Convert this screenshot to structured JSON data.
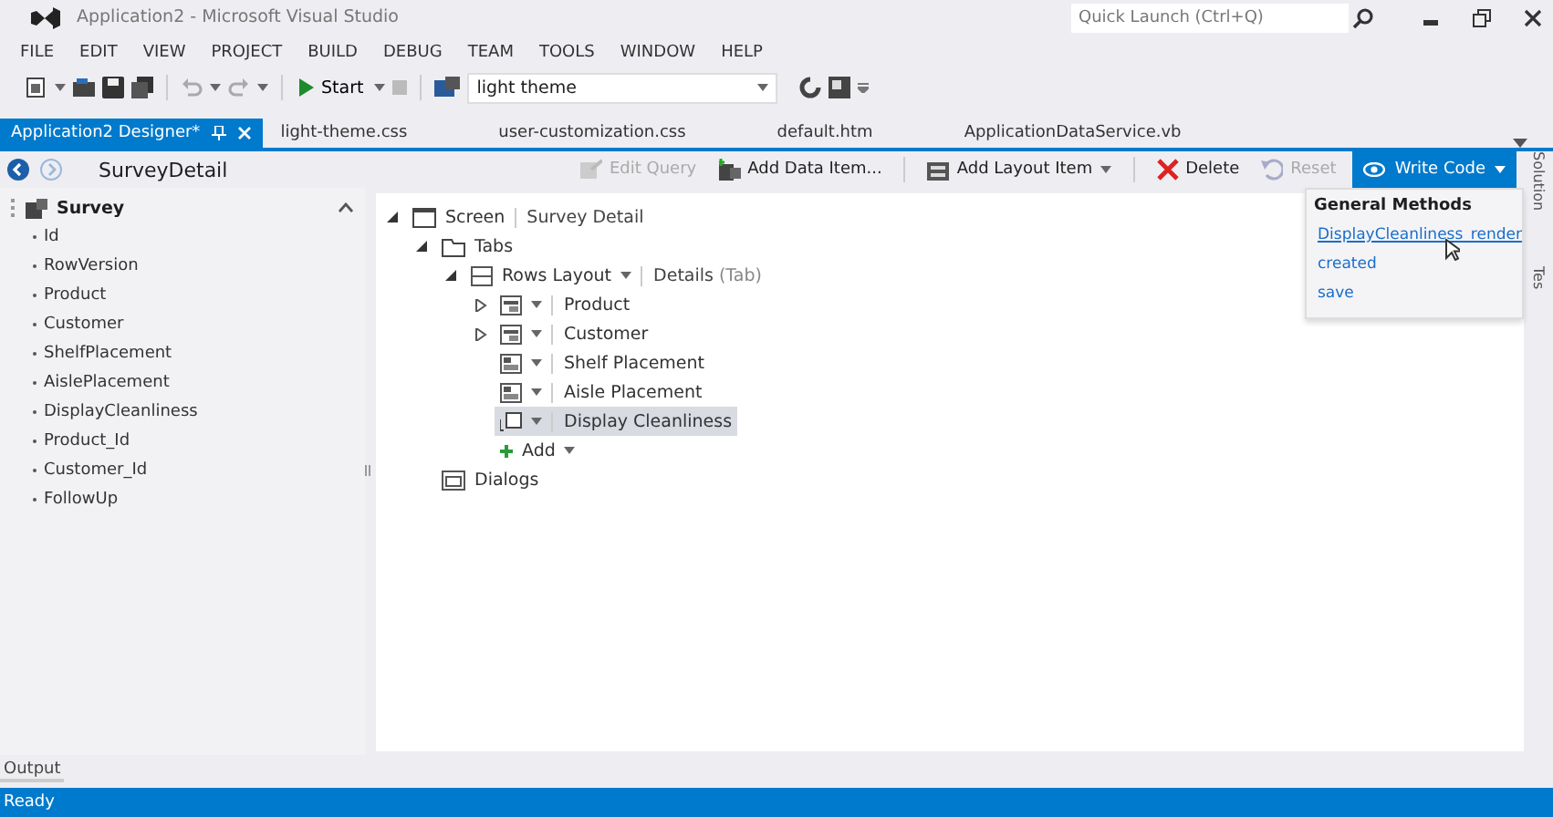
{
  "window": {
    "title": "Application2 - Microsoft Visual Studio",
    "quick_launch": {
      "placeholder": "Quick Launch (Ctrl+Q)"
    }
  },
  "menu": [
    "FILE",
    "EDIT",
    "VIEW",
    "PROJECT",
    "BUILD",
    "DEBUG",
    "TEAM",
    "TOOLS",
    "WINDOW",
    "HELP"
  ],
  "toolbar": {
    "start": "Start",
    "configuration": "light theme"
  },
  "tabs": [
    {
      "label": "Application2 Designer*",
      "selected": true
    },
    {
      "label": "light-theme.css",
      "selected": false
    },
    {
      "label": "user-customization.css",
      "selected": false
    },
    {
      "label": "default.htm",
      "selected": false
    },
    {
      "label": "ApplicationDataService.vb",
      "selected": false
    }
  ],
  "designer": {
    "screen_name": "SurveyDetail",
    "actions": [
      {
        "kind": "query",
        "label": "Edit Query",
        "disabled": true
      },
      {
        "kind": "data",
        "label": "Add Data Item...",
        "disabled": false
      },
      {
        "kind": "layout",
        "label": "Add Layout Item",
        "disabled": false
      },
      {
        "kind": "delete",
        "label": "Delete",
        "disabled": false
      },
      {
        "kind": "reset",
        "label": "Reset",
        "disabled": true
      }
    ],
    "write_code": "Write Code"
  },
  "entity": {
    "name": "Survey",
    "fields": [
      "Id",
      "RowVersion",
      "Product",
      "Customer",
      "ShelfPlacement",
      "AislePlacement",
      "DisplayCleanliness",
      "Product_Id",
      "Customer_Id",
      "FollowUp"
    ]
  },
  "tree": [
    {
      "kind": "screen",
      "label": "Screen",
      "detail": "Survey Detail",
      "expanded": true,
      "selected": false,
      "children": [
        {
          "kind": "tabs",
          "label": "Tabs",
          "expanded": true,
          "selected": false,
          "children": [
            {
              "kind": "rows",
              "label": "Rows Layout",
              "detail": "Details",
              "suffix": "(Tab)",
              "expanded": true,
              "selected": false,
              "children": [
                {
                  "kind": "group",
                  "label": "Product",
                  "expanded": false,
                  "selected": false
                },
                {
                  "kind": "group",
                  "label": "Customer",
                  "expanded": false,
                  "selected": false
                },
                {
                  "kind": "field",
                  "label": "Shelf Placement",
                  "selected": false
                },
                {
                  "kind": "field",
                  "label": "Aisle Placement",
                  "selected": false
                },
                {
                  "kind": "check",
                  "label": "Display Cleanliness",
                  "selected": true
                },
                {
                  "kind": "add",
                  "label": "Add",
                  "selected": false
                }
              ]
            }
          ]
        },
        {
          "kind": "dialogs",
          "label": "Dialogs",
          "selected": false
        }
      ]
    }
  ],
  "write_code_menu": {
    "heading": "General Methods",
    "items": [
      {
        "label": "DisplayCleanliness_render",
        "hovered": true
      },
      {
        "label": "created",
        "hovered": false
      },
      {
        "label": "save",
        "hovered": false
      }
    ]
  },
  "side_tabs": [
    "Solution",
    "Tes"
  ],
  "output_tab": "Output",
  "status_bar": "Ready"
}
